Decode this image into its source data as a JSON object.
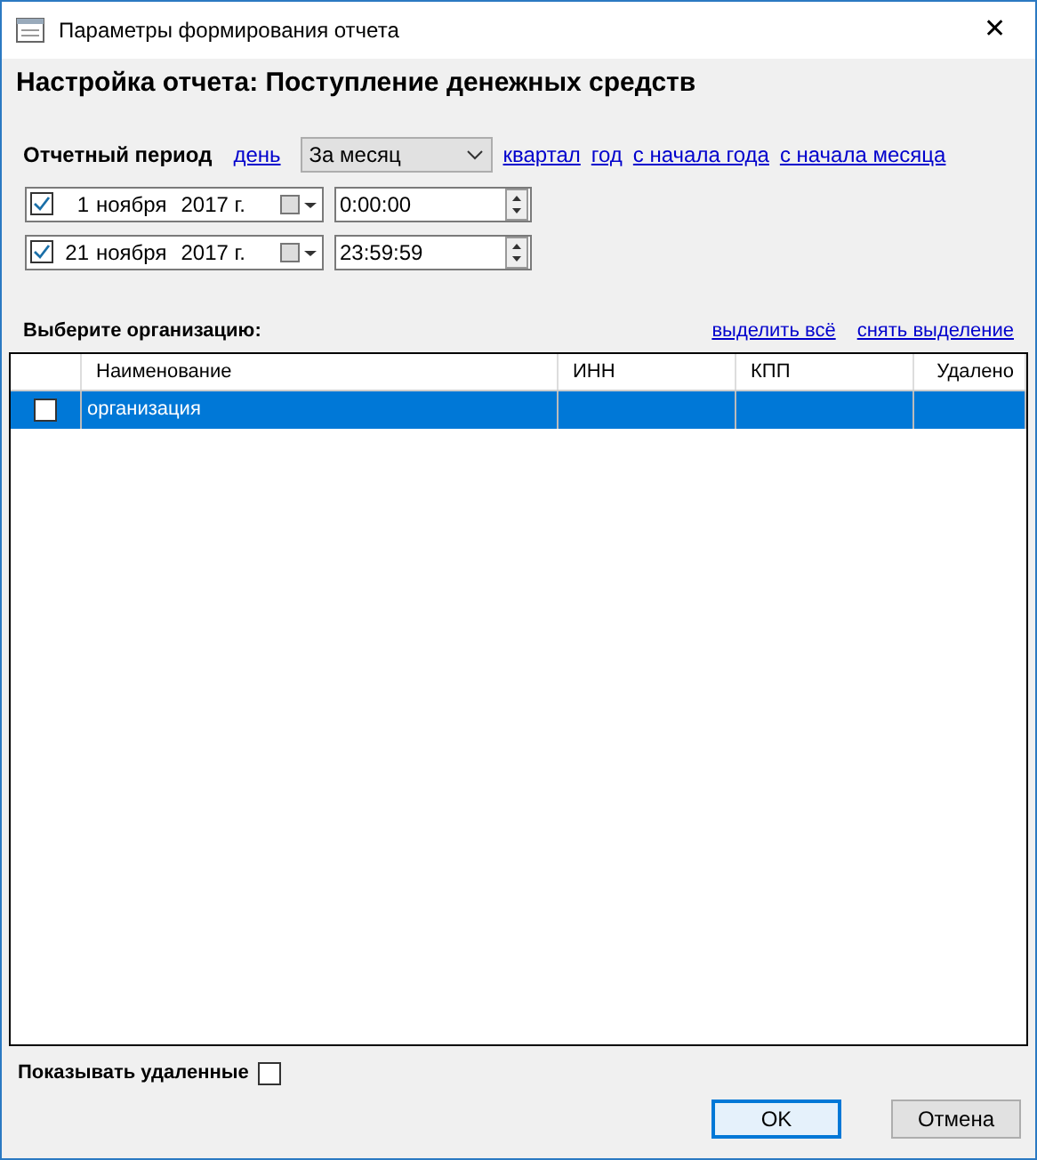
{
  "window": {
    "title": "Параметры формирования отчета",
    "close": "✕"
  },
  "heading": "Настройка отчета: Поступление денежных средств",
  "period": {
    "label": "Отчетный период",
    "links_before": [
      "день"
    ],
    "select": {
      "value": "За месяц"
    },
    "links_after": [
      "квартал",
      "год",
      "с начала года",
      "с начала месяца"
    ]
  },
  "dates": [
    {
      "checked": true,
      "day": "1",
      "month": "ноября",
      "year": "2017 г.",
      "time": "0:00:00"
    },
    {
      "checked": true,
      "day": "21",
      "month": "ноября",
      "year": "2017 г.",
      "time": "23:59:59"
    }
  ],
  "organizations": {
    "label": "Выберите организацию:",
    "links": [
      "выделить всё",
      "снять выделение"
    ],
    "table": {
      "columns": [
        "Наименование",
        "ИНН",
        "КПП",
        "Удалено"
      ],
      "rows": [
        {
          "selected": true,
          "checked": false,
          "cells": [
            "организация",
            "",
            "",
            ""
          ]
        }
      ]
    }
  },
  "show_deleted": {
    "label": "Показывать удаленные",
    "checked": false
  },
  "buttons": [
    {
      "label": "OK",
      "default": true
    },
    {
      "label": "Отмена",
      "default": false
    }
  ]
}
